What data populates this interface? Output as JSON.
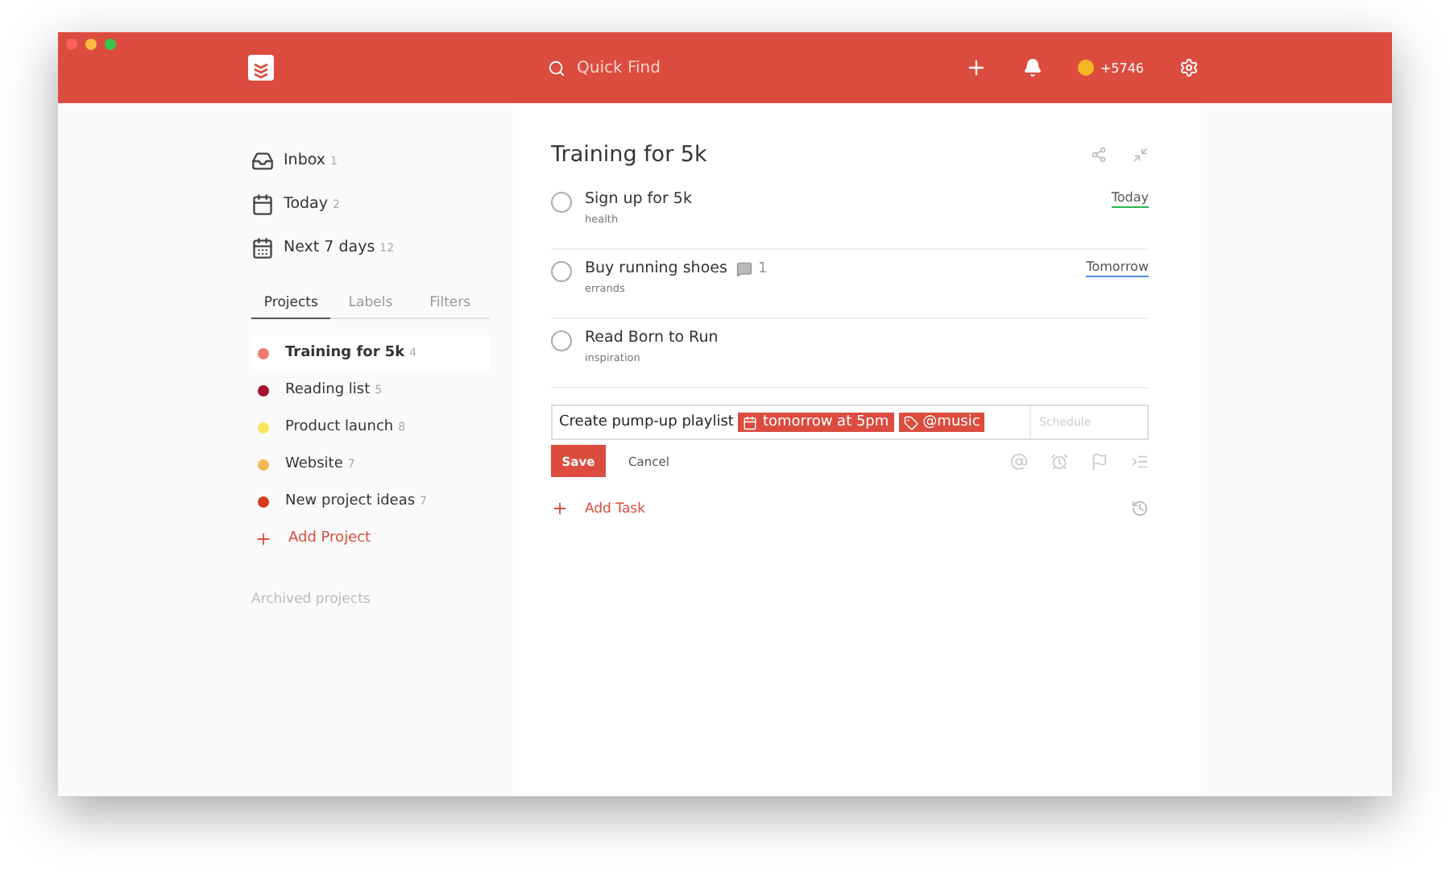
{
  "toolbar": {
    "search": {
      "placeholder": "Quick Find"
    },
    "karma": "+5746"
  },
  "sidebar": {
    "filters": [
      {
        "kind": "inbox",
        "label": "Inbox",
        "count": "1"
      },
      {
        "kind": "today",
        "label": "Today",
        "count": "2"
      },
      {
        "kind": "week",
        "label": "Next 7 days",
        "count": "12"
      }
    ],
    "tabs": [
      {
        "label": "Projects",
        "selected": true
      },
      {
        "label": "Labels",
        "selected": false
      },
      {
        "label": "Filters",
        "selected": false
      }
    ],
    "projects": [
      {
        "name": "Training for 5k",
        "count": "4",
        "color": "#f07a6e",
        "selected": true
      },
      {
        "name": "Reading list",
        "count": "5",
        "color": "#a5102e",
        "selected": false
      },
      {
        "name": "Product launch",
        "count": "8",
        "color": "#f7e65c",
        "selected": false
      },
      {
        "name": "Website",
        "count": "7",
        "color": "#f8b555",
        "selected": false
      },
      {
        "name": "New project ideas",
        "count": "7",
        "color": "#d93a1e",
        "selected": false
      }
    ],
    "add_project": "Add Project",
    "archived": "Archived projects"
  },
  "main": {
    "title": "Training for 5k",
    "tasks": [
      {
        "name": "Sign up for 5k",
        "label": "health",
        "checked": false,
        "date": "Today",
        "color": "#25b84c"
      },
      {
        "name": "Buy running shoes",
        "label": "errands",
        "checked": false,
        "comments": "1",
        "date": "Tomorrow",
        "color": "#4a90e2"
      },
      {
        "name": "Read Born to Run",
        "label": "inspiration",
        "checked": false
      }
    ],
    "editor": {
      "text": "Create pump-up playlist",
      "date_tag": "tomorrow at 5pm",
      "label_tag": "@music",
      "schedule_placeholder": "Schedule",
      "save": "Save",
      "cancel": "Cancel"
    },
    "add_task": "Add Task"
  }
}
